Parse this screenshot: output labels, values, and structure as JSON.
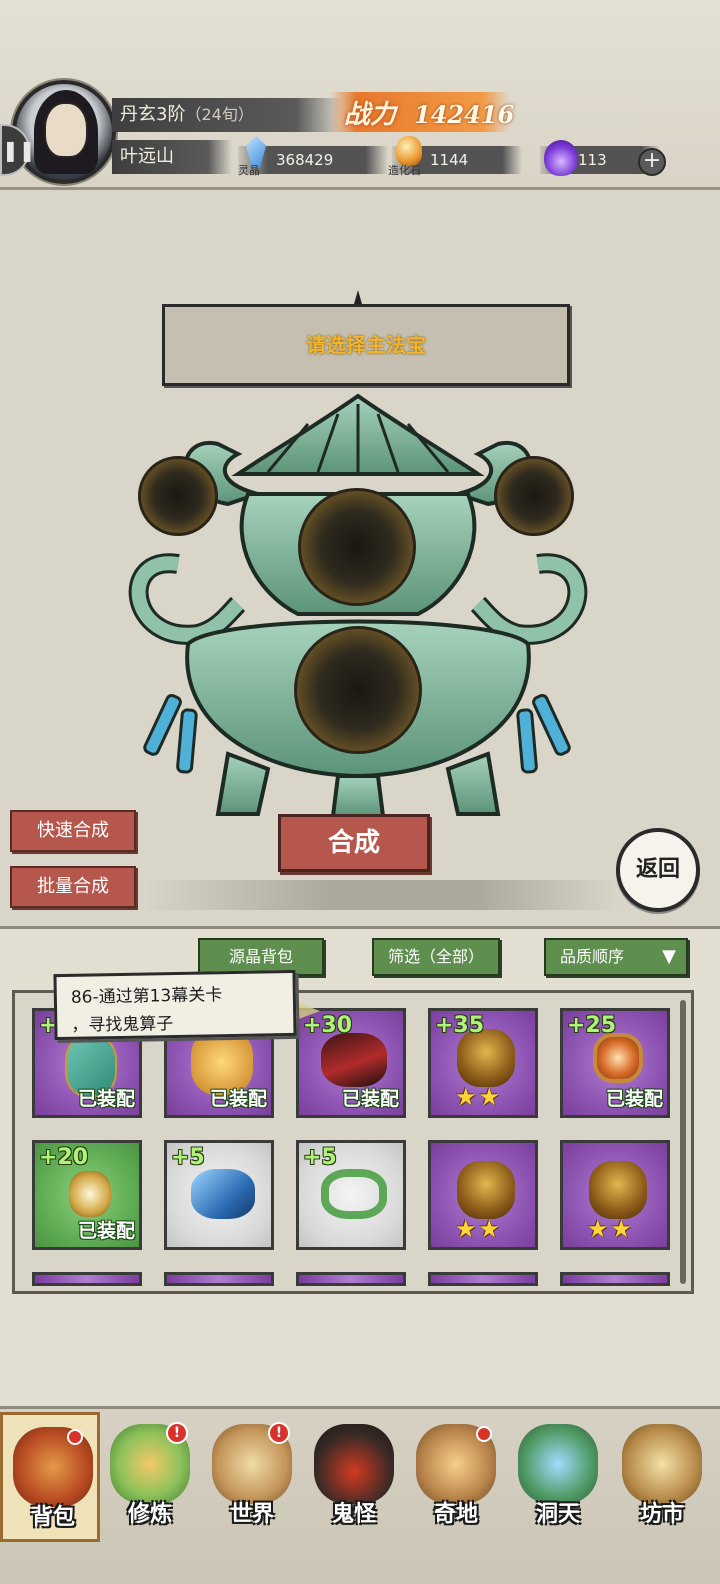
{
  "header": {
    "realm": "丹玄3阶",
    "age": "（24旬）",
    "player_name": "叶远山",
    "power_label": "战力",
    "power_value": "142416",
    "resources": [
      {
        "icon": "spirit-crystal-icon",
        "caption": "灵晶",
        "value": "368429"
      },
      {
        "icon": "creation-stone-icon",
        "caption": "造化石",
        "value": "1144"
      },
      {
        "icon": "soul-flame-icon",
        "caption": "",
        "value": "113"
      }
    ],
    "add_label": "+"
  },
  "craft": {
    "prompt": "请选择主法宝",
    "quick_label": "快速合成",
    "batch_label": "批量合成",
    "synth_label": "合成",
    "return_label": "返回"
  },
  "inventory": {
    "tab_bag": "源晶背包",
    "tab_filter": "筛选（全部）",
    "tab_sort": "品质顺序",
    "sort_icon": "chevron-down-icon",
    "equipped_label": "已装配",
    "quest_line1": "86-通过第13幕关卡",
    "quest_line2": "，寻找鬼算子",
    "items": [
      {
        "level": "+",
        "rarity": "purple",
        "art": "mirror",
        "equipped": true,
        "stars": 0
      },
      {
        "level": "",
        "rarity": "purple",
        "art": "gold",
        "equipped": true,
        "stars": 0
      },
      {
        "level": "+30",
        "rarity": "purple",
        "art": "armor",
        "equipped": true,
        "stars": 0
      },
      {
        "level": "+35",
        "rarity": "purple",
        "art": "beast",
        "equipped": false,
        "stars": 2
      },
      {
        "level": "+25",
        "rarity": "purple",
        "art": "orb",
        "equipped": true,
        "stars": 0
      },
      {
        "level": "+20",
        "rarity": "green",
        "art": "pendant",
        "equipped": true,
        "stars": 0
      },
      {
        "level": "+5",
        "rarity": "white",
        "art": "boot",
        "equipped": false,
        "stars": 0
      },
      {
        "level": "+5",
        "rarity": "white",
        "art": "wreath",
        "equipped": false,
        "stars": 0
      },
      {
        "level": "",
        "rarity": "purple",
        "art": "beast",
        "equipped": false,
        "stars": 2
      },
      {
        "level": "",
        "rarity": "purple",
        "art": "beast",
        "equipped": false,
        "stars": 2
      }
    ]
  },
  "nav": {
    "items": [
      {
        "label": "背包",
        "badge": "dot"
      },
      {
        "label": "修炼",
        "badge": "!"
      },
      {
        "label": "世界",
        "badge": "!"
      },
      {
        "label": "鬼怪",
        "badge": ""
      },
      {
        "label": "奇地",
        "badge": "dot"
      },
      {
        "label": "洞天",
        "badge": ""
      },
      {
        "label": "坊市",
        "badge": ""
      }
    ]
  },
  "colors": {
    "accent_red": "#b5574d",
    "tab_green": "#5e8f4e",
    "prompt_gold": "#f4b52a",
    "power_orange": "#e77a2c",
    "equip_green": "#aef47a"
  }
}
